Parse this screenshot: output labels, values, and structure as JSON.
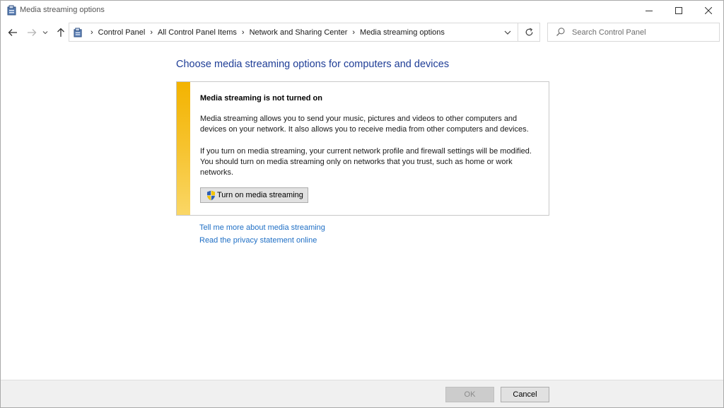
{
  "window": {
    "title": "Media streaming options"
  },
  "breadcrumb": {
    "items": [
      "Control Panel",
      "All Control Panel Items",
      "Network and Sharing Center",
      "Media streaming options"
    ]
  },
  "search": {
    "placeholder": "Search Control Panel",
    "value": ""
  },
  "main": {
    "heading": "Choose media streaming options for computers and devices",
    "notice": {
      "title": "Media streaming is not turned on",
      "paragraph1": "Media streaming allows you to send your music, pictures and videos to other computers and devices on your network.  It also allows you to receive media from other computers and devices.",
      "paragraph2": "If you turn on media streaming, your current network profile and firewall settings will be modified. You should turn on media streaming only on networks that you trust, such as home or work networks.",
      "button_label": "Turn on media streaming"
    },
    "links": [
      "Tell me more about media streaming",
      "Read the privacy statement online"
    ]
  },
  "footer": {
    "ok_label": "OK",
    "cancel_label": "Cancel",
    "ok_enabled": false
  },
  "colors": {
    "heading": "#1e3d96",
    "link": "#1f6fc5",
    "notice_stripe": "#f3b300"
  }
}
